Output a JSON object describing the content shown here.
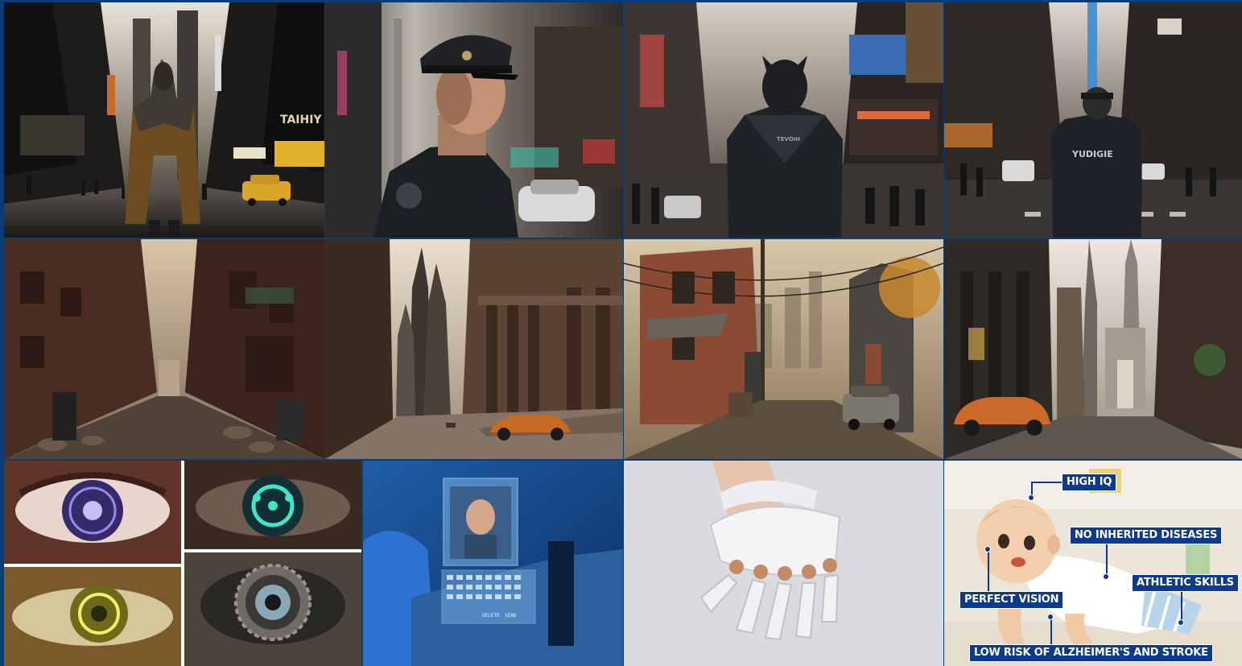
{
  "tiles": [
    {
      "id": "cloaked-figure-city-street",
      "sign": "TAIHIY"
    },
    {
      "id": "police-officer-portrait"
    },
    {
      "id": "armored-figure-city-street",
      "patch": "TEVOIH"
    },
    {
      "id": "officer-back-view-street",
      "patch": "YUDIGIE"
    },
    {
      "id": "brick-alley"
    },
    {
      "id": "classical-building-sports-car"
    },
    {
      "id": "small-town-street-old-car"
    },
    {
      "id": "gothic-street-sports-car"
    },
    {
      "id": "bionic-eyes-collage"
    },
    {
      "id": "wrist-projection-video-call",
      "keys": [
        "DELETE",
        "SEND"
      ]
    },
    {
      "id": "robotic-hand"
    },
    {
      "id": "designer-baby-infographic"
    }
  ],
  "infographic": {
    "labels": {
      "high_iq": "HIGH IQ",
      "no_inherited_diseases": "NO INHERITED DISEASES",
      "athletic_skills": "ATHLETIC SKILLS",
      "perfect_vision": "PERFECT VISION",
      "low_risk": "LOW RISK OF ALZHEIMER'S AND STROKE"
    }
  },
  "colors": {
    "frame": "#0c3c74",
    "callout_bg": "#0d3a8a",
    "callout_text": "#ffffff"
  }
}
